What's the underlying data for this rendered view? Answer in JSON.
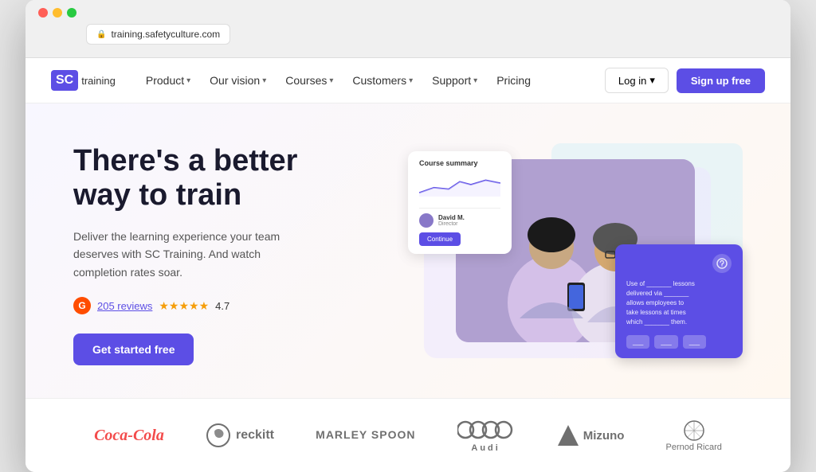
{
  "browser": {
    "url": "training.safetyculture.com",
    "dots": [
      "red",
      "yellow",
      "green"
    ]
  },
  "nav": {
    "logo_sc": "SC",
    "logo_text": "training",
    "items": [
      {
        "label": "Product",
        "has_dropdown": true
      },
      {
        "label": "Our vision",
        "has_dropdown": true
      },
      {
        "label": "Courses",
        "has_dropdown": true
      },
      {
        "label": "Customers",
        "has_dropdown": true
      },
      {
        "label": "Support",
        "has_dropdown": true
      },
      {
        "label": "Pricing",
        "has_dropdown": false
      }
    ],
    "login_label": "Log in",
    "signup_label": "Sign up free"
  },
  "hero": {
    "title_line1": "There's a better",
    "title_line2": "way to train",
    "subtitle": "Deliver the learning experience your team deserves with SC Training. And watch completion rates soar.",
    "reviews_count": "205 reviews",
    "rating": "4.7",
    "cta_label": "Get started free"
  },
  "course_card": {
    "title": "Course summary",
    "user_name": "David M.",
    "user_role": "Director",
    "continue_label": "Continue"
  },
  "quiz_card": {
    "text_line1": "Use of _______ lessons",
    "text_line2": "delivered via _______",
    "text_line3": "allows employees to",
    "text_line4": "take lessons at times",
    "text_line5": "which _______ them.",
    "options": [
      "___",
      "___",
      "___"
    ]
  },
  "logos": [
    {
      "name": "Coca-Cola",
      "style": "coca-cola"
    },
    {
      "name": "reckitt",
      "style": "reckitt"
    },
    {
      "name": "MARLEY SPOON",
      "style": "marley-spoon"
    },
    {
      "name": "Audi",
      "style": "audi"
    },
    {
      "name": "Mizuno",
      "style": "mizuno"
    },
    {
      "name": "Pernod Ricard",
      "style": "pernod"
    }
  ],
  "colors": {
    "accent": "#5c4ee5",
    "brand_red": "#ff4d00"
  }
}
